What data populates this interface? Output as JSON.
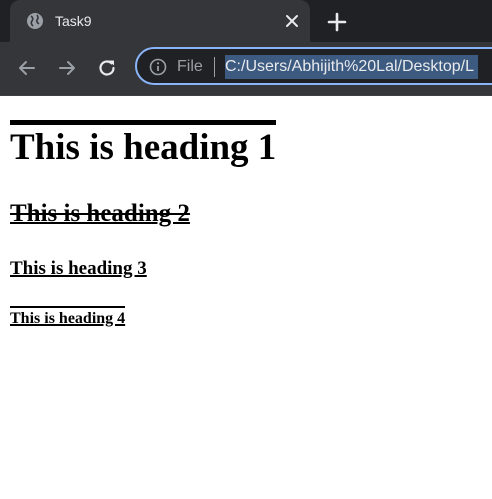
{
  "browser": {
    "tab": {
      "title": "Task9",
      "favicon_icon": "globe-icon",
      "close_icon": "close-icon"
    },
    "new_tab_icon": "plus-icon",
    "toolbar": {
      "back_icon": "arrow-left-icon",
      "forward_icon": "arrow-right-icon",
      "reload_icon": "reload-icon"
    },
    "omnibox": {
      "info_icon": "info-icon",
      "scheme_label": "File",
      "url": "C:/Users/Abhijith%20Lal/Desktop/L",
      "accent_color": "#8ab4f8",
      "selection_color": "#3d5a80"
    }
  },
  "page": {
    "heading1": "This is heading 1",
    "heading2": "This is heading 2",
    "heading3": "This is heading 3",
    "heading4": "This is heading 4"
  }
}
